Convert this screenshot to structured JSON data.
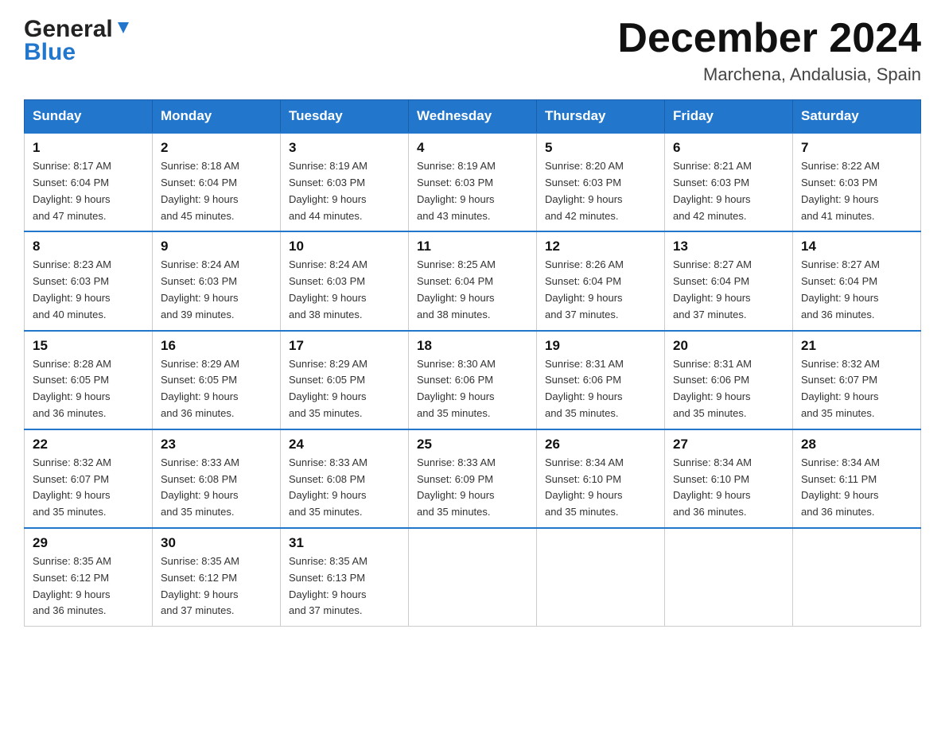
{
  "header": {
    "logo_general": "General",
    "logo_blue": "Blue",
    "month_title": "December 2024",
    "location": "Marchena, Andalusia, Spain"
  },
  "days_of_week": [
    "Sunday",
    "Monday",
    "Tuesday",
    "Wednesday",
    "Thursday",
    "Friday",
    "Saturday"
  ],
  "weeks": [
    [
      {
        "day": "1",
        "sunrise": "8:17 AM",
        "sunset": "6:04 PM",
        "daylight": "9 hours and 47 minutes."
      },
      {
        "day": "2",
        "sunrise": "8:18 AM",
        "sunset": "6:04 PM",
        "daylight": "9 hours and 45 minutes."
      },
      {
        "day": "3",
        "sunrise": "8:19 AM",
        "sunset": "6:03 PM",
        "daylight": "9 hours and 44 minutes."
      },
      {
        "day": "4",
        "sunrise": "8:19 AM",
        "sunset": "6:03 PM",
        "daylight": "9 hours and 43 minutes."
      },
      {
        "day": "5",
        "sunrise": "8:20 AM",
        "sunset": "6:03 PM",
        "daylight": "9 hours and 42 minutes."
      },
      {
        "day": "6",
        "sunrise": "8:21 AM",
        "sunset": "6:03 PM",
        "daylight": "9 hours and 42 minutes."
      },
      {
        "day": "7",
        "sunrise": "8:22 AM",
        "sunset": "6:03 PM",
        "daylight": "9 hours and 41 minutes."
      }
    ],
    [
      {
        "day": "8",
        "sunrise": "8:23 AM",
        "sunset": "6:03 PM",
        "daylight": "9 hours and 40 minutes."
      },
      {
        "day": "9",
        "sunrise": "8:24 AM",
        "sunset": "6:03 PM",
        "daylight": "9 hours and 39 minutes."
      },
      {
        "day": "10",
        "sunrise": "8:24 AM",
        "sunset": "6:03 PM",
        "daylight": "9 hours and 38 minutes."
      },
      {
        "day": "11",
        "sunrise": "8:25 AM",
        "sunset": "6:04 PM",
        "daylight": "9 hours and 38 minutes."
      },
      {
        "day": "12",
        "sunrise": "8:26 AM",
        "sunset": "6:04 PM",
        "daylight": "9 hours and 37 minutes."
      },
      {
        "day": "13",
        "sunrise": "8:27 AM",
        "sunset": "6:04 PM",
        "daylight": "9 hours and 37 minutes."
      },
      {
        "day": "14",
        "sunrise": "8:27 AM",
        "sunset": "6:04 PM",
        "daylight": "9 hours and 36 minutes."
      }
    ],
    [
      {
        "day": "15",
        "sunrise": "8:28 AM",
        "sunset": "6:05 PM",
        "daylight": "9 hours and 36 minutes."
      },
      {
        "day": "16",
        "sunrise": "8:29 AM",
        "sunset": "6:05 PM",
        "daylight": "9 hours and 36 minutes."
      },
      {
        "day": "17",
        "sunrise": "8:29 AM",
        "sunset": "6:05 PM",
        "daylight": "9 hours and 35 minutes."
      },
      {
        "day": "18",
        "sunrise": "8:30 AM",
        "sunset": "6:06 PM",
        "daylight": "9 hours and 35 minutes."
      },
      {
        "day": "19",
        "sunrise": "8:31 AM",
        "sunset": "6:06 PM",
        "daylight": "9 hours and 35 minutes."
      },
      {
        "day": "20",
        "sunrise": "8:31 AM",
        "sunset": "6:06 PM",
        "daylight": "9 hours and 35 minutes."
      },
      {
        "day": "21",
        "sunrise": "8:32 AM",
        "sunset": "6:07 PM",
        "daylight": "9 hours and 35 minutes."
      }
    ],
    [
      {
        "day": "22",
        "sunrise": "8:32 AM",
        "sunset": "6:07 PM",
        "daylight": "9 hours and 35 minutes."
      },
      {
        "day": "23",
        "sunrise": "8:33 AM",
        "sunset": "6:08 PM",
        "daylight": "9 hours and 35 minutes."
      },
      {
        "day": "24",
        "sunrise": "8:33 AM",
        "sunset": "6:08 PM",
        "daylight": "9 hours and 35 minutes."
      },
      {
        "day": "25",
        "sunrise": "8:33 AM",
        "sunset": "6:09 PM",
        "daylight": "9 hours and 35 minutes."
      },
      {
        "day": "26",
        "sunrise": "8:34 AM",
        "sunset": "6:10 PM",
        "daylight": "9 hours and 35 minutes."
      },
      {
        "day": "27",
        "sunrise": "8:34 AM",
        "sunset": "6:10 PM",
        "daylight": "9 hours and 36 minutes."
      },
      {
        "day": "28",
        "sunrise": "8:34 AM",
        "sunset": "6:11 PM",
        "daylight": "9 hours and 36 minutes."
      }
    ],
    [
      {
        "day": "29",
        "sunrise": "8:35 AM",
        "sunset": "6:12 PM",
        "daylight": "9 hours and 36 minutes."
      },
      {
        "day": "30",
        "sunrise": "8:35 AM",
        "sunset": "6:12 PM",
        "daylight": "9 hours and 37 minutes."
      },
      {
        "day": "31",
        "sunrise": "8:35 AM",
        "sunset": "6:13 PM",
        "daylight": "9 hours and 37 minutes."
      },
      null,
      null,
      null,
      null
    ]
  ],
  "labels": {
    "sunrise": "Sunrise:",
    "sunset": "Sunset:",
    "daylight": "Daylight:"
  }
}
